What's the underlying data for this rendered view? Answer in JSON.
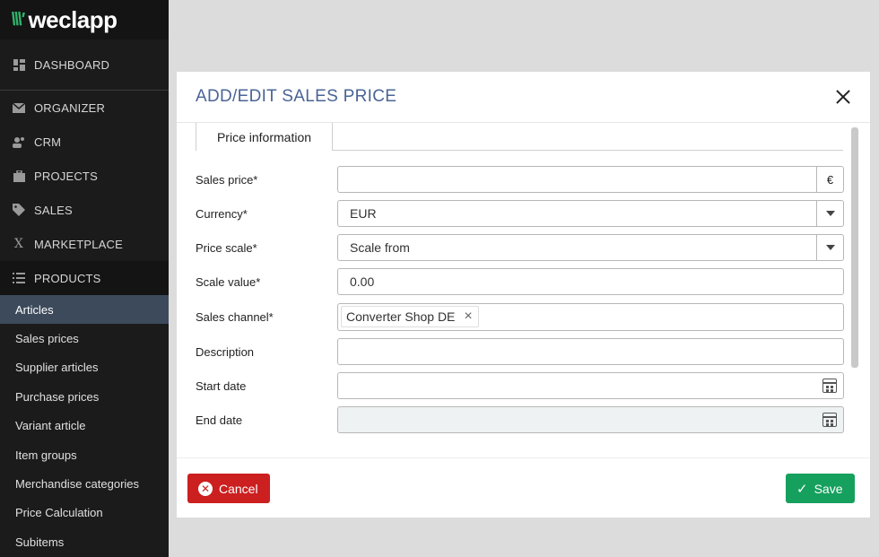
{
  "app": {
    "logo_mark": "\\\\\\'",
    "logo_text": "weclapp"
  },
  "sidebar": {
    "nav": [
      {
        "label": "DASHBOARD",
        "icon": "dashboard-icon"
      },
      {
        "label": "ORGANIZER",
        "icon": "mail-icon"
      },
      {
        "label": "CRM",
        "icon": "users-icon"
      },
      {
        "label": "PROJECTS",
        "icon": "briefcase-icon"
      },
      {
        "label": "SALES",
        "icon": "tag-icon"
      },
      {
        "label": "MARKETPLACE",
        "icon": "marketplace-icon"
      },
      {
        "label": "PRODUCTS",
        "icon": "list-icon"
      }
    ],
    "sub_items": [
      {
        "label": "Articles",
        "active": true
      },
      {
        "label": "Sales prices"
      },
      {
        "label": "Supplier articles"
      },
      {
        "label": "Purchase prices"
      },
      {
        "label": "Variant article"
      },
      {
        "label": "Item groups"
      },
      {
        "label": "Merchandise categories"
      },
      {
        "label": "Price Calculation"
      },
      {
        "label": "Subitems"
      }
    ]
  },
  "modal": {
    "title": "ADD/EDIT SALES PRICE",
    "tab": "Price information",
    "fields": {
      "sales_price": {
        "label": "Sales price*",
        "value": "",
        "currency_symbol": "€"
      },
      "currency": {
        "label": "Currency*",
        "value": "EUR"
      },
      "price_scale": {
        "label": "Price scale*",
        "value": "Scale from"
      },
      "scale_value": {
        "label": "Scale value*",
        "value": "0.00"
      },
      "sales_channel": {
        "label": "Sales channel*",
        "chip": "Converter Shop DE",
        "chip_remove": "×"
      },
      "description": {
        "label": "Description",
        "value": ""
      },
      "start_date": {
        "label": "Start date",
        "value": ""
      },
      "end_date": {
        "label": "End date",
        "value": ""
      }
    },
    "cancel_label": "Cancel",
    "save_label": "Save"
  },
  "colors": {
    "sidebar_bg": "#1b1b1b",
    "active_item_bg": "#3c4a5c",
    "title": "#4a6496",
    "cancel": "#cc1f1f",
    "save": "#16a05d",
    "brand_green": "#2eb36b"
  }
}
